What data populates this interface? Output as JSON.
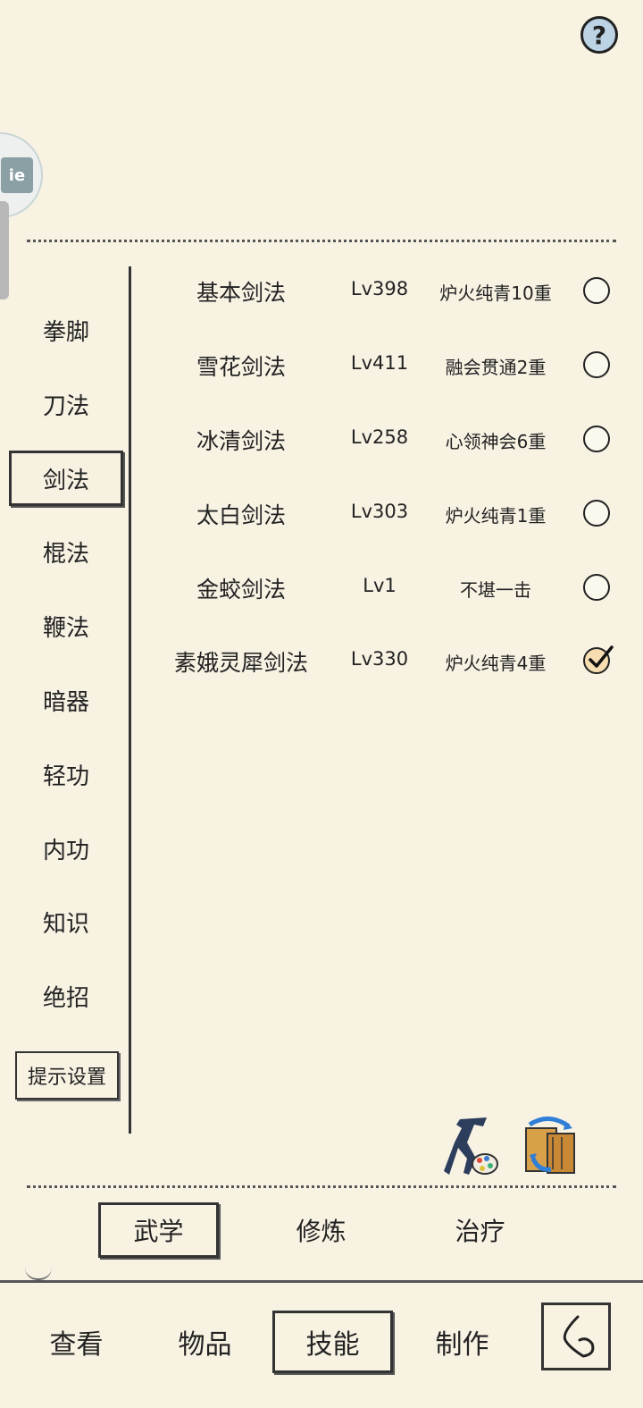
{
  "header": {
    "help_icon": "help-icon",
    "help_label": "?"
  },
  "float_ball": {
    "label": "ie"
  },
  "categories": [
    {
      "label": "拳脚"
    },
    {
      "label": "刀法"
    },
    {
      "label": "剑法",
      "active": true
    },
    {
      "label": "棍法"
    },
    {
      "label": "鞭法"
    },
    {
      "label": "暗器"
    },
    {
      "label": "轻功"
    },
    {
      "label": "内功"
    },
    {
      "label": "知识"
    },
    {
      "label": "绝招"
    }
  ],
  "hint_settings": "提示设置",
  "skills": [
    {
      "name": "基本剑法",
      "level": "Lv398",
      "rank": "炉火纯青10重",
      "checked": false
    },
    {
      "name": "雪花剑法",
      "level": "Lv411",
      "rank": "融会贯通2重",
      "checked": false
    },
    {
      "name": "冰清剑法",
      "level": "Lv258",
      "rank": "心领神会6重",
      "checked": false
    },
    {
      "name": "太白剑法",
      "level": "Lv303",
      "rank": "炉火纯青1重",
      "checked": false
    },
    {
      "name": "金蛟剑法",
      "level": "Lv1",
      "rank": "不堪一击",
      "checked": false
    },
    {
      "name": "素娥灵犀剑法",
      "level": "Lv330",
      "rank": "炉火纯青4重",
      "checked": true
    }
  ],
  "tools": {
    "warrior_icon": "swordsman-palette-icon",
    "swap_icon": "book-swap-icon"
  },
  "subtabs": [
    {
      "label": "武学",
      "active": true
    },
    {
      "label": "修炼"
    },
    {
      "label": "治疗"
    }
  ],
  "nav": [
    {
      "label": "查看"
    },
    {
      "label": "物品"
    },
    {
      "label": "技能",
      "active": true
    },
    {
      "label": "制作"
    }
  ],
  "back_icon": "back-arrow-icon"
}
